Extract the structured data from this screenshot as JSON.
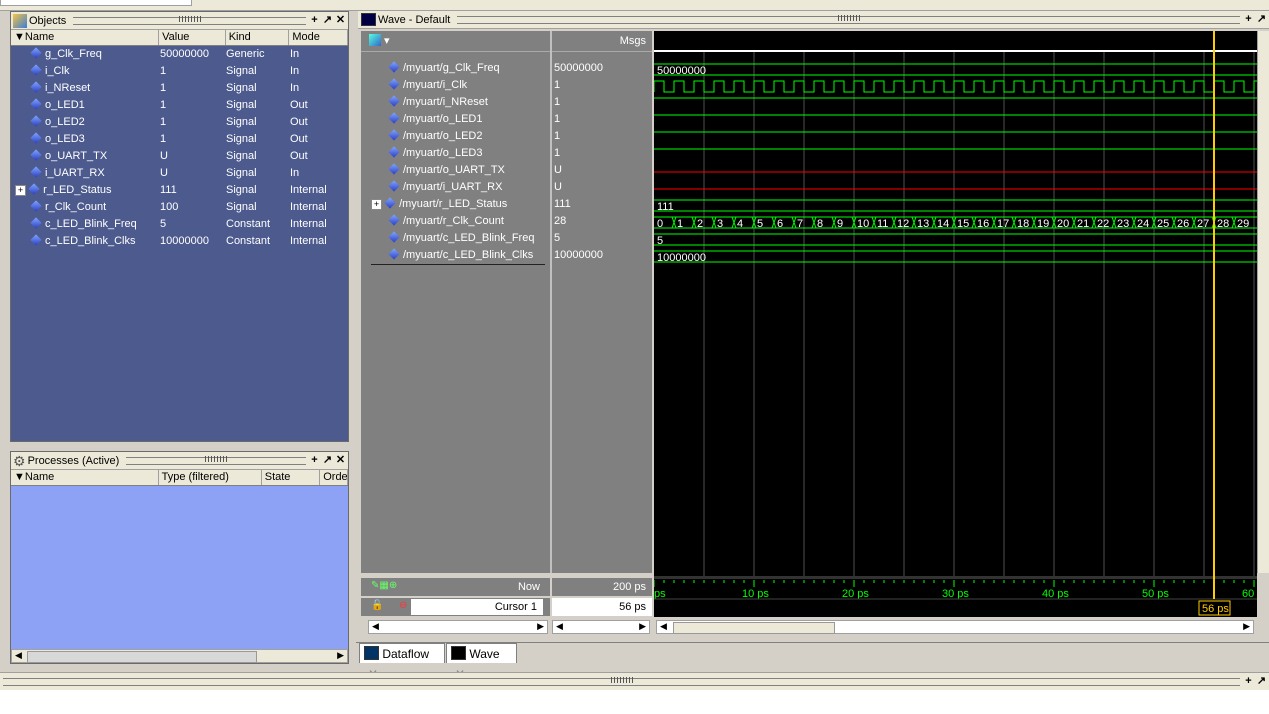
{
  "objects": {
    "title": "Objects",
    "columns": [
      "Name",
      "Value",
      "Kind",
      "Mode"
    ],
    "rows": [
      {
        "name": "g_Clk_Freq",
        "value": "50000000",
        "kind": "Generic",
        "mode": "In"
      },
      {
        "name": "i_Clk",
        "value": "1",
        "kind": "Signal",
        "mode": "In"
      },
      {
        "name": "i_NReset",
        "value": "1",
        "kind": "Signal",
        "mode": "In"
      },
      {
        "name": "o_LED1",
        "value": "1",
        "kind": "Signal",
        "mode": "Out"
      },
      {
        "name": "o_LED2",
        "value": "1",
        "kind": "Signal",
        "mode": "Out"
      },
      {
        "name": "o_LED3",
        "value": "1",
        "kind": "Signal",
        "mode": "Out"
      },
      {
        "name": "o_UART_TX",
        "value": "U",
        "kind": "Signal",
        "mode": "Out"
      },
      {
        "name": "i_UART_RX",
        "value": "U",
        "kind": "Signal",
        "mode": "In"
      },
      {
        "name": "r_LED_Status",
        "value": "111",
        "kind": "Signal",
        "mode": "Internal"
      },
      {
        "name": "r_Clk_Count",
        "value": "100",
        "kind": "Signal",
        "mode": "Internal"
      },
      {
        "name": "c_LED_Blink_Freq",
        "value": "5",
        "kind": "Constant",
        "mode": "Internal"
      },
      {
        "name": "c_LED_Blink_Clks",
        "value": "10000000",
        "kind": "Constant",
        "mode": "Internal"
      }
    ]
  },
  "processes": {
    "title": "Processes (Active)",
    "columns": [
      "Name",
      "Type (filtered)",
      "State",
      "Orde"
    ]
  },
  "wave": {
    "title": "Wave - Default",
    "msgs_label": "Msgs",
    "signals": [
      {
        "path": "/myuart/g_Clk_Freq",
        "value": "50000000"
      },
      {
        "path": "/myuart/i_Clk",
        "value": "1"
      },
      {
        "path": "/myuart/i_NReset",
        "value": "1"
      },
      {
        "path": "/myuart/o_LED1",
        "value": "1"
      },
      {
        "path": "/myuart/o_LED2",
        "value": "1"
      },
      {
        "path": "/myuart/o_LED3",
        "value": "1"
      },
      {
        "path": "/myuart/o_UART_TX",
        "value": "U"
      },
      {
        "path": "/myuart/i_UART_RX",
        "value": "U"
      },
      {
        "path": "/myuart/r_LED_Status",
        "value": "111"
      },
      {
        "path": "/myuart/r_Clk_Count",
        "value": "28"
      },
      {
        "path": "/myuart/c_LED_Blink_Freq",
        "value": "5"
      },
      {
        "path": "/myuart/c_LED_Blink_Clks",
        "value": "10000000"
      }
    ],
    "trace_labels": {
      "g_clk_freq": "50000000",
      "r_led_status": "111",
      "c_led_blink_freq": "5",
      "c_led_blink_clks": "10000000"
    },
    "count_values": [
      "0",
      "1",
      "2",
      "3",
      "4",
      "5",
      "6",
      "7",
      "8",
      "9",
      "10",
      "11",
      "12",
      "13",
      "14",
      "15",
      "16",
      "17",
      "18",
      "19",
      "20",
      "21",
      "22",
      "23",
      "24",
      "25",
      "26",
      "27",
      "28",
      "29"
    ],
    "now_label": "Now",
    "now_value": "200 ps",
    "cursor_label": "Cursor 1",
    "cursor_value": "56 ps",
    "cursor_marker": "56 ps",
    "cursor_time": 56,
    "time_ticks": [
      "ps",
      "10 ps",
      "20 ps",
      "30 ps",
      "40 ps",
      "50 ps",
      "60"
    ],
    "colors": {
      "wave": "#00ff00",
      "undefined": "#ff0000",
      "cursor": "#ffcc00",
      "bg": "#000000"
    }
  },
  "tabs": [
    {
      "label": "Dataflow",
      "icon": "dataflow-icon"
    },
    {
      "label": "Wave",
      "icon": "wave-icon"
    }
  ]
}
